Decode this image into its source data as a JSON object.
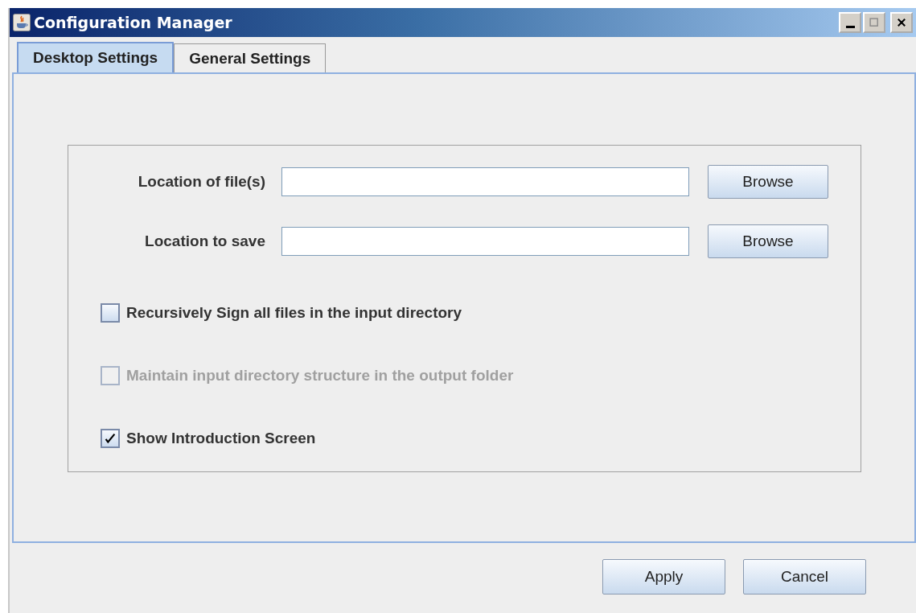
{
  "window": {
    "title": "Configuration Manager"
  },
  "tabs": [
    {
      "label": "Desktop Settings",
      "selected": true
    },
    {
      "label": "General Settings",
      "selected": false
    }
  ],
  "fields": [
    {
      "label": "Location of file(s)",
      "button": "Browse"
    },
    {
      "label": "Location to save",
      "button": "Browse"
    }
  ],
  "checkboxes": [
    {
      "label": "Recursively Sign all files in the input directory",
      "checked": false,
      "disabled": false
    },
    {
      "label": "Maintain input directory structure in the output folder",
      "checked": false,
      "disabled": true
    },
    {
      "label": "Show Introduction Screen",
      "checked": true,
      "disabled": false
    }
  ],
  "buttons": [
    "Apply",
    "Cancel"
  ]
}
